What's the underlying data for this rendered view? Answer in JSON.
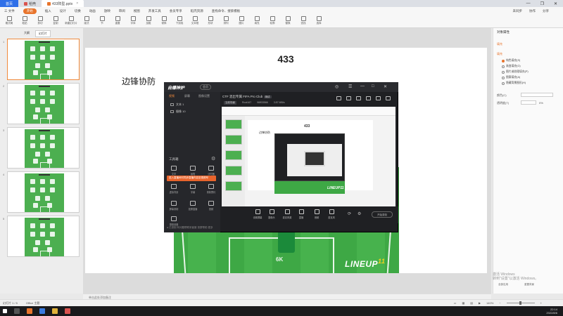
{
  "titlebar": {
    "home_label": "首页",
    "tabs": [
      {
        "label": "稻壳",
        "active": false
      },
      {
        "label": "433阵型.pptx",
        "active": true
      }
    ],
    "window_controls": [
      "—",
      "❐",
      "✕"
    ]
  },
  "menubar": {
    "file_label": "三 文件",
    "items": [
      "开始",
      "插入",
      "设计",
      "切换",
      "动画",
      "放映",
      "审阅",
      "视图",
      "开发工具",
      "会员专享",
      "稻壳资源"
    ],
    "active_item": "开始",
    "search_placeholder": "查找命令、搜索模板",
    "right_items": [
      "未同步",
      "协作",
      "分享"
    ]
  },
  "ribbon": {
    "buttons": [
      "格式刷",
      "粘贴",
      "剪切",
      "复制",
      "新建幻灯片",
      "版式",
      "节",
      "重置",
      "字体",
      "加粗",
      "倾斜",
      "下划线",
      "文本框",
      "形状",
      "排列",
      "图片",
      "填充",
      "轮廓",
      "替换",
      "查找",
      "选择"
    ]
  },
  "slide_panel": {
    "tabs": [
      "大纲",
      "幻灯片"
    ],
    "active_tab": "幻灯片",
    "slide_numbers": [
      "1",
      "2",
      "3",
      "4",
      "5"
    ],
    "selected_slide": 1
  },
  "slide": {
    "title": "433",
    "heading": "边锋协防",
    "player_label": "6K",
    "logo_text": "LINEUP",
    "logo_number": "11"
  },
  "recorder": {
    "logo": "自爆神炉",
    "badge": "会员",
    "window_buttons": [
      "◎",
      "☰",
      "—",
      "□",
      "✕"
    ],
    "side_tabs": [
      "视频",
      "屏幕",
      "图像设置"
    ],
    "active_side_tab": "视频",
    "sources": [
      {
        "label": "文本 1"
      },
      {
        "label": "摄像 10"
      }
    ],
    "tools_title": "工具箱",
    "tools": [
      {
        "label": "文字"
      },
      {
        "label": "画笔"
      },
      {
        "label": "计时器"
      },
      {
        "label": "虚拟背景"
      },
      {
        "label": "字幕"
      },
      {
        "label": "录制预约"
      },
      {
        "label": "屏幕录制"
      },
      {
        "label": "投屏直播"
      },
      {
        "label": "音频"
      },
      {
        "label": "录制设置"
      }
    ],
    "tip": "进入直播间可同步直播内容至视频号",
    "status": "● 已录制  有问题帮联系客服  录屏帮助  更多",
    "project_title": "CTF 混出专属 FIFA Pro Club",
    "project_tag": "测试",
    "info_items": [
      "当前场景",
      "Root167",
      "96ff33566",
      "3.87 MB/s"
    ],
    "preview_title": "433",
    "preview_heading": "边锋协防",
    "preview_logo": "LINEUP11",
    "bottom_tools": [
      {
        "label": "设置屏幕"
      },
      {
        "label": "摄像头"
      },
      {
        "label": "麦克风源"
      },
      {
        "label": "直播"
      },
      {
        "label": "音频"
      },
      {
        "label": "麦克风"
      }
    ],
    "start_label": "开始录制"
  },
  "right_pane": {
    "title": "对象属性",
    "section": "填充",
    "fill_label": "填充",
    "fill_options": [
      {
        "label": "纯色填充(S)",
        "on": true
      },
      {
        "label": "渐变填充(G)",
        "on": false
      },
      {
        "label": "图片或纹理填充(P)",
        "on": false
      },
      {
        "label": "图案填充(A)",
        "on": false
      },
      {
        "label": "隐藏背景图形(H)",
        "on": false
      }
    ],
    "color_label": "颜色(C)",
    "transparency_label": "透明度(T)",
    "transparency_value": "0%",
    "apply_label": "全部应用",
    "reset_label": "重置背景"
  },
  "watermark": {
    "line1": "激活 Windows",
    "line2": "转到\"设置\"以激活 Windows。"
  },
  "notes_placeholder": "单击此处添加备注",
  "statusbar": {
    "slide_info": "幻灯片 1 / 5",
    "theme": "Office 主题",
    "zoom": "140%"
  },
  "taskbar": {
    "time": "22:14",
    "date": "2022/8/6"
  },
  "colors": {
    "accent": "#e8742c",
    "pitch_green": "#3ea845",
    "recorder_bg": "#1f2023"
  }
}
